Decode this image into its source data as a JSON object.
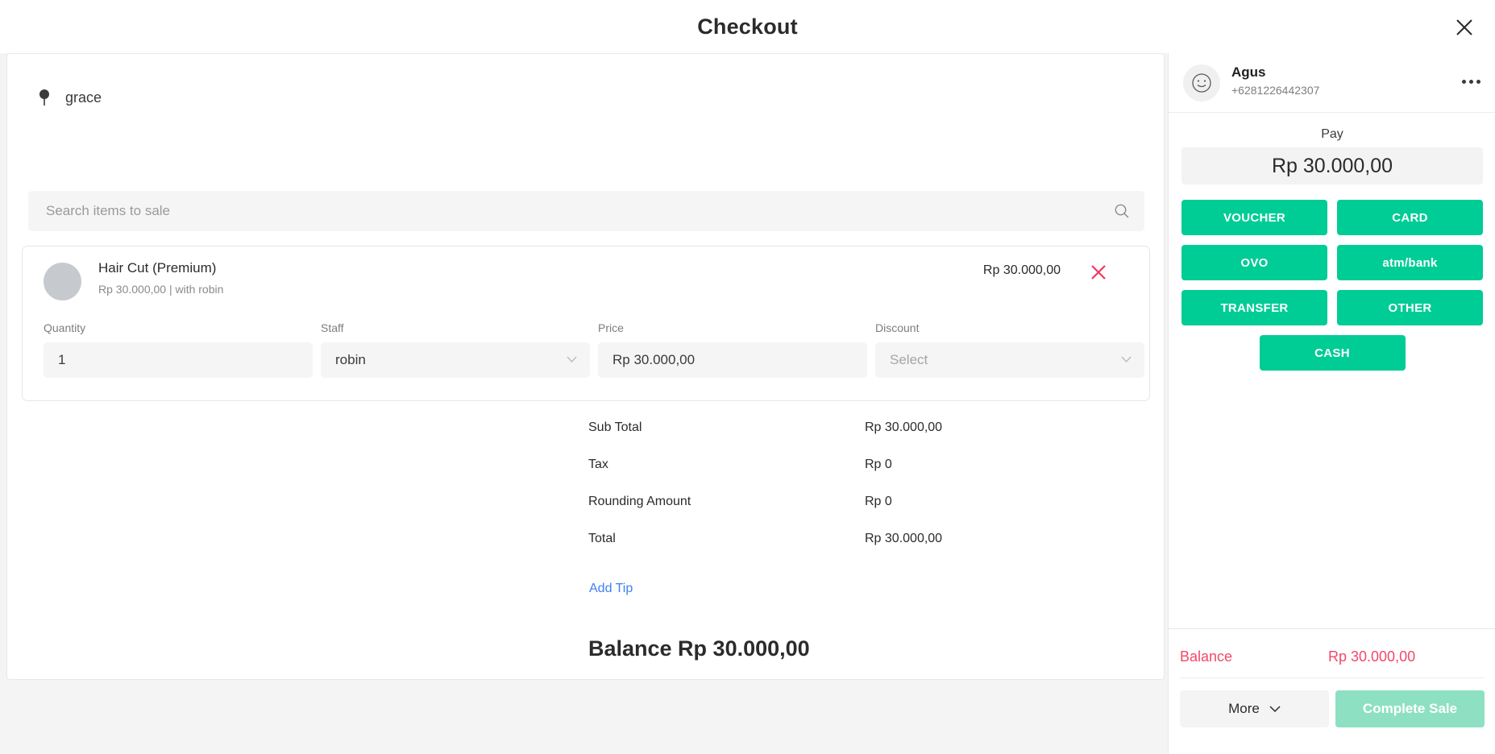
{
  "header": {
    "title": "Checkout",
    "close_icon": "close-icon"
  },
  "left": {
    "location": {
      "icon": "map-pin-icon",
      "name": "grace"
    },
    "search": {
      "placeholder": "Search items to sale",
      "value": "",
      "icon": "search-icon"
    },
    "item": {
      "name": "Hair Cut (Premium)",
      "subtitle": "Rp 30.000,00 | with robin",
      "price": "Rp 30.000,00",
      "remove_icon": "close-icon",
      "fields": {
        "quantity_label": "Quantity",
        "quantity_value": "1",
        "staff_label": "Staff",
        "staff_value": "robin",
        "price_label": "Price",
        "price_value": "Rp 30.000,00",
        "discount_label": "Discount",
        "discount_placeholder": "Select"
      }
    },
    "totals": [
      {
        "label": "Sub Total",
        "value": "Rp 30.000,00"
      },
      {
        "label": "Tax",
        "value": "Rp 0"
      },
      {
        "label": "Rounding Amount",
        "value": "Rp 0"
      },
      {
        "label": "Total",
        "value": "Rp 30.000,00"
      }
    ],
    "add_tip": "Add Tip",
    "balance_heading": "Balance Rp 30.000,00"
  },
  "sidebar": {
    "customer": {
      "name": "Agus",
      "phone": "+6281226442307",
      "avatar_icon": "smiley-face-icon",
      "more_icon": "ellipsis-icon"
    },
    "pay_label": "Pay",
    "pay_amount": "Rp 30.000,00",
    "payment_methods": [
      "VOUCHER",
      "CARD",
      "OVO",
      "atm/bank",
      "TRANSFER",
      "OTHER"
    ],
    "payment_cash": "CASH",
    "footer": {
      "balance_label": "Balance",
      "balance_value": "Rp 30.000,00",
      "more_label": "More",
      "more_icon": "chevron-down-icon",
      "complete_label": "Complete Sale"
    }
  },
  "colors": {
    "accent_green": "#00cc96",
    "complete_green": "#8ee0c3",
    "balance_red": "#f4476b",
    "link_blue": "#3d7ff5",
    "remove_red": "#f4365f"
  }
}
